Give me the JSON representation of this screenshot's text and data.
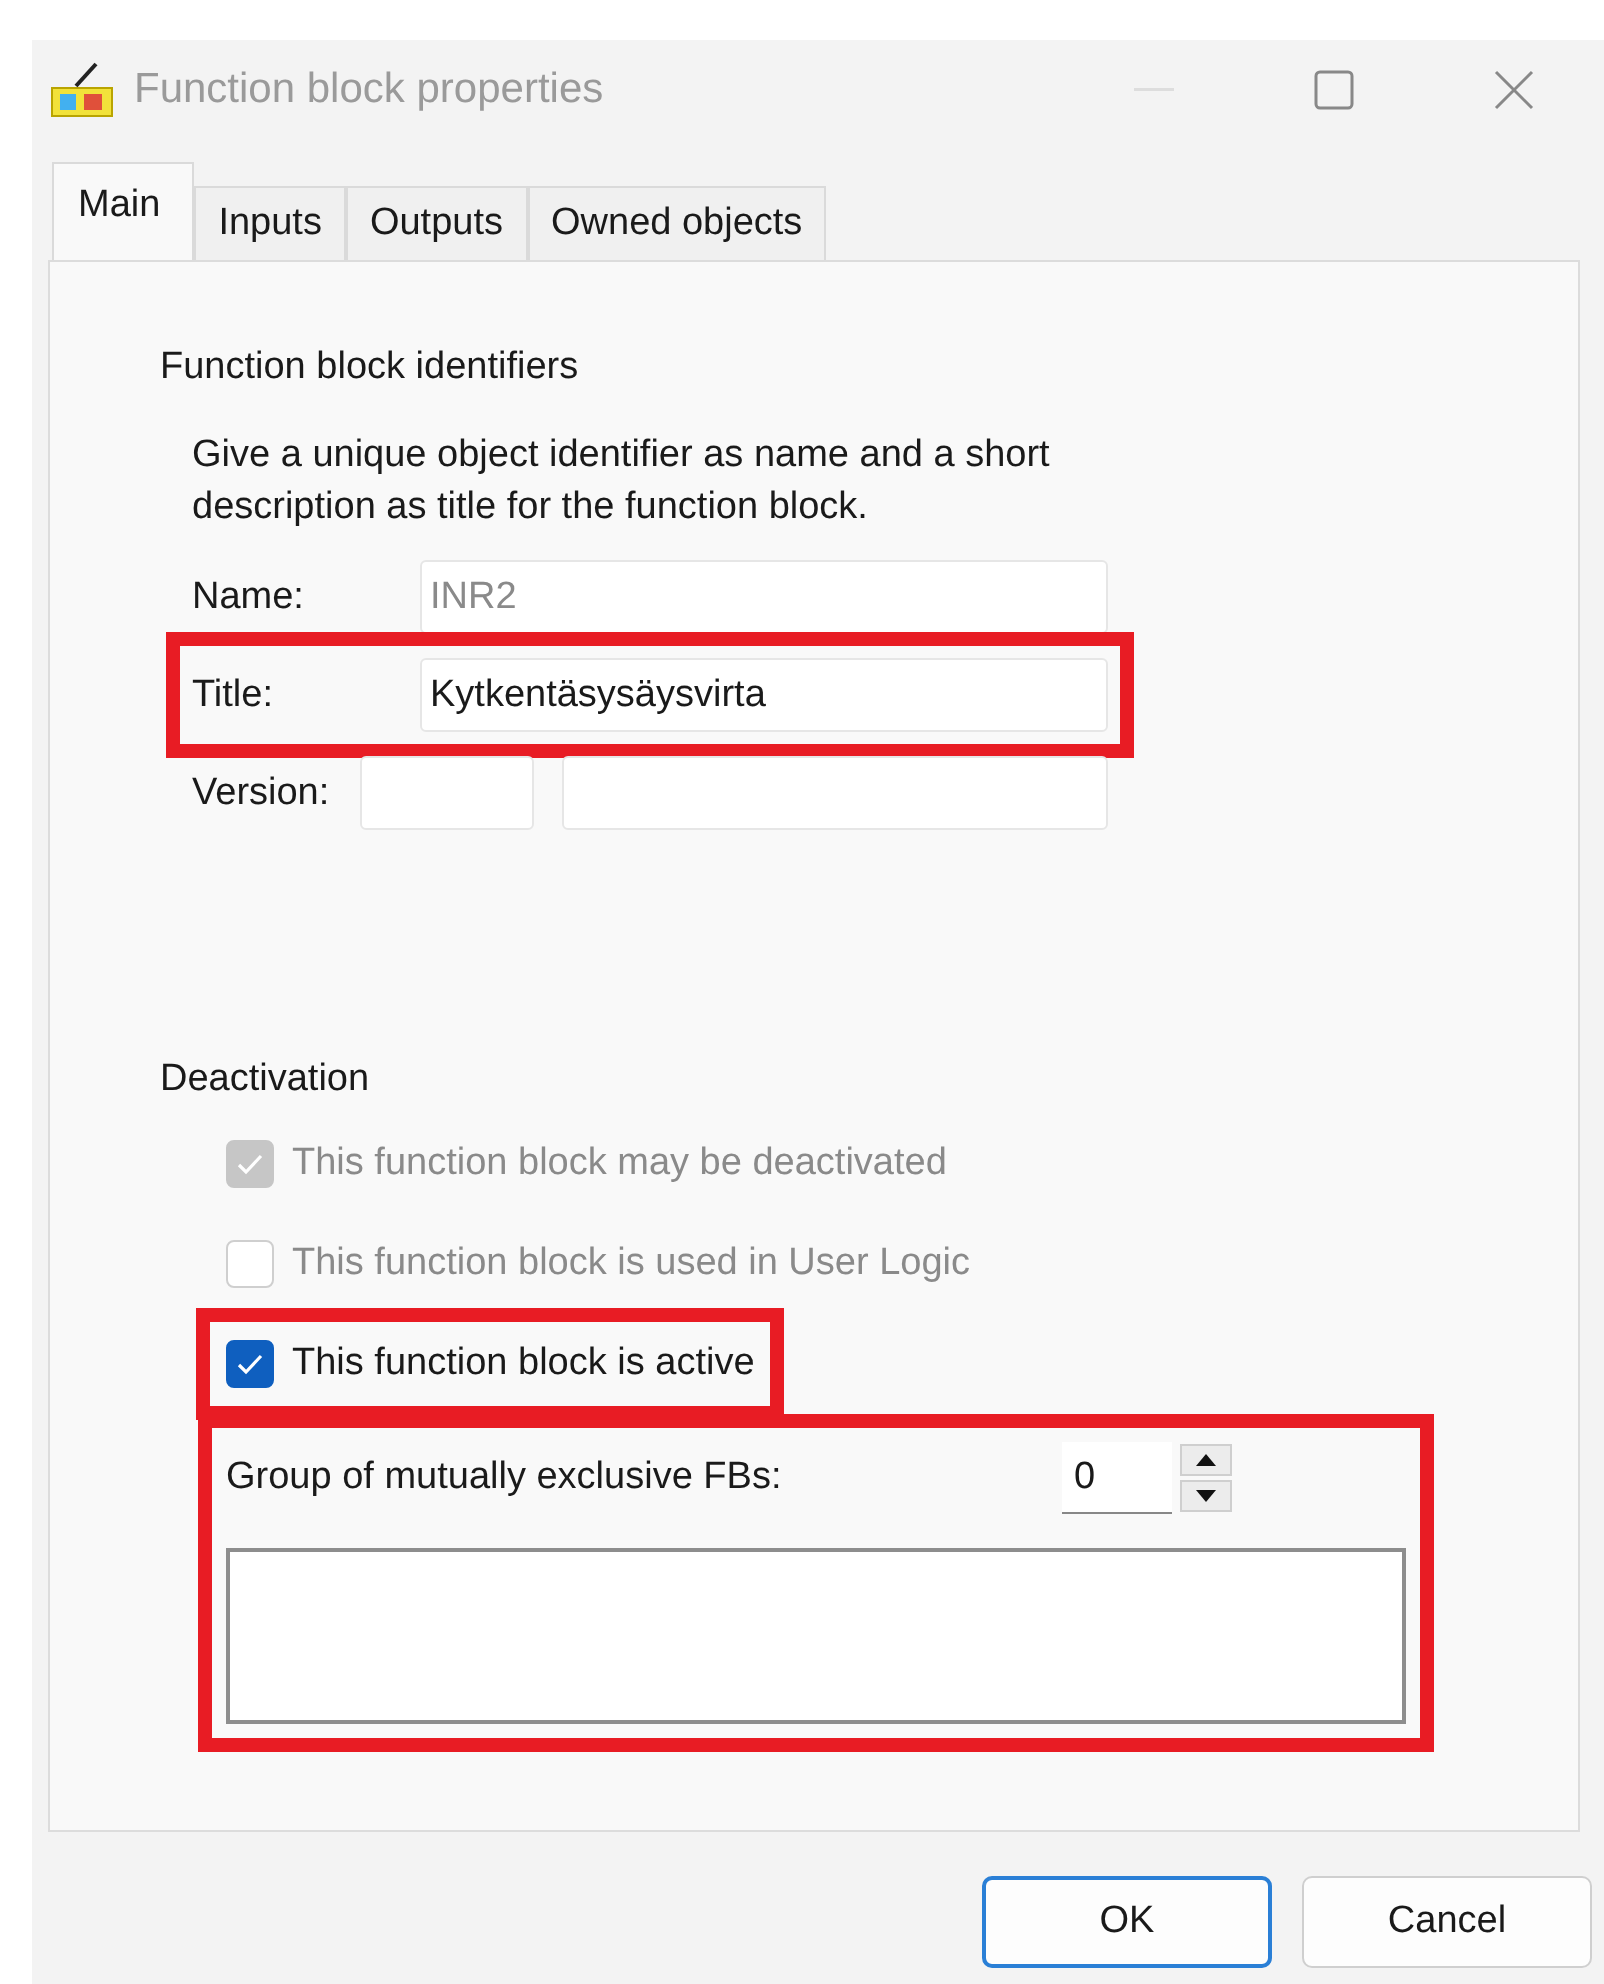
{
  "window": {
    "title": "Function block properties"
  },
  "tabs": [
    {
      "label": "Main",
      "selected": true
    },
    {
      "label": "Inputs",
      "selected": false
    },
    {
      "label": "Outputs",
      "selected": false
    },
    {
      "label": "Owned objects",
      "selected": false
    }
  ],
  "identifiers": {
    "heading": "Function block identifiers",
    "description": "Give a unique object identifier as name and a short description as title for the function block.",
    "fields": [
      {
        "label": "Name:",
        "value": "INR2",
        "disabled": true,
        "highlighted": false
      },
      {
        "label": "Title:",
        "value": "Kytkentäsysäysvirta",
        "disabled": false,
        "highlighted": true
      }
    ],
    "version": {
      "label": "Version:"
    }
  },
  "deactivation": {
    "heading": "Deactivation",
    "checkboxes": [
      {
        "label": "This function block may be deactivated",
        "checked": true,
        "disabled": true,
        "highlighted": false
      },
      {
        "label": "This function block is used in User Logic",
        "checked": false,
        "disabled": true,
        "highlighted": false
      },
      {
        "label": "This function block is active",
        "checked": true,
        "disabled": false,
        "highlighted": true
      }
    ],
    "group": {
      "label": "Group of mutually exclusive FBs:",
      "value": "0",
      "highlighted": true
    }
  },
  "buttons": [
    {
      "label": "OK",
      "default": true
    },
    {
      "label": "Cancel",
      "default": false
    }
  ]
}
